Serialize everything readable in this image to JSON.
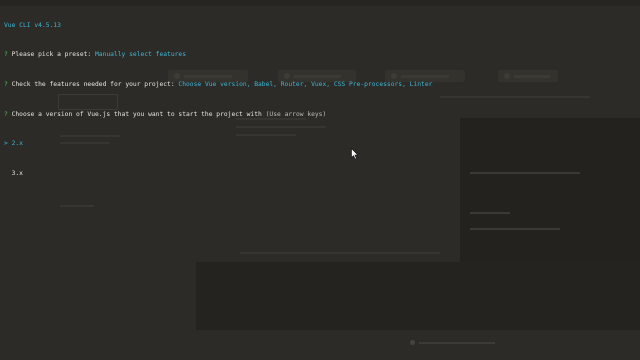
{
  "terminal": {
    "header": "Vue CLI v4.5.13",
    "line1": {
      "prefix": "?",
      "question": "Please pick a preset:",
      "answer": "Manually select features"
    },
    "line2": {
      "prefix": "?",
      "question": "Check the features needed for your project:",
      "answer": "Choose Vue version, Babel, Router, Vuex, CSS Pre-processors, Linter"
    },
    "line3": {
      "prefix": "?",
      "question": "Choose a version of Vue.js that you want to start the project with",
      "hint": "(Use arrow keys)"
    },
    "options": [
      {
        "pointer": ">",
        "label": "2.x"
      },
      {
        "pointer": " ",
        "label": "3.x"
      }
    ]
  },
  "colors": {
    "accent_cyan": "#3fb7d4",
    "prompt_green": "#55c55a",
    "background": "#2c2b27"
  },
  "icons": {
    "cursor": "mouse-pointer-icon"
  }
}
